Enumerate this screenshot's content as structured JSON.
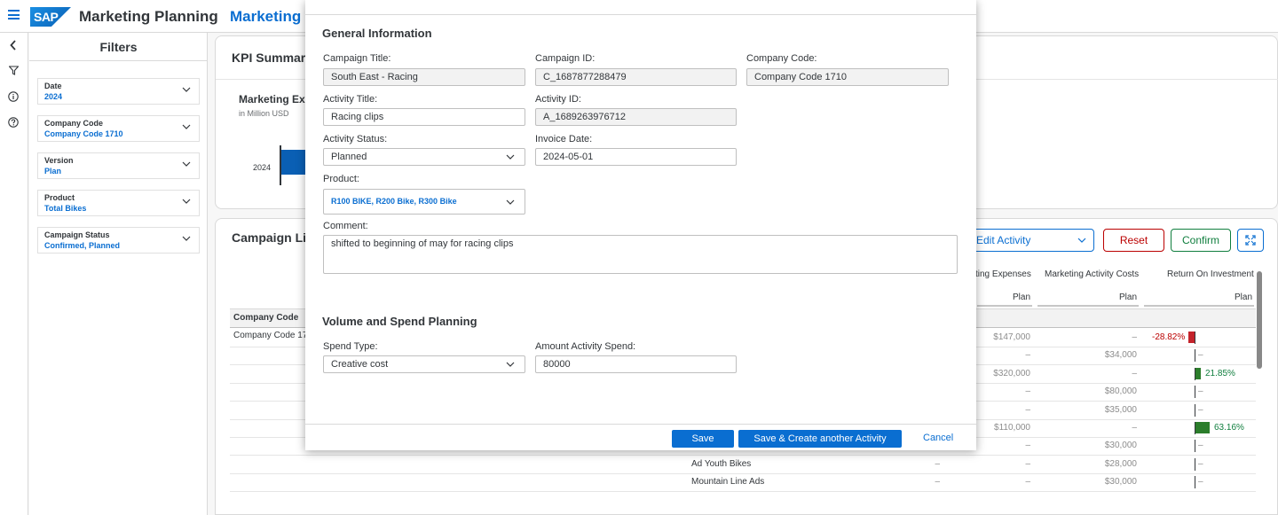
{
  "shell": {
    "logo": "SAP",
    "title": "Marketing Planning",
    "app_title": "Marketing Ca"
  },
  "filters": {
    "title": "Filters",
    "items": [
      {
        "label": "Date",
        "value": "2024"
      },
      {
        "label": "Company Code",
        "value": "Company Code 1710"
      },
      {
        "label": "Version",
        "value": "Plan"
      },
      {
        "label": "Product",
        "value": "Total Bikes"
      },
      {
        "label": "Campaign Status",
        "value": "Confirmed, Planned"
      }
    ]
  },
  "kpi": {
    "title": "KPI Summary",
    "chart_title": "Marketing Expe",
    "chart_subtitle": "in Million USD",
    "year": "2024"
  },
  "campaign_list": {
    "title": "Campaign List",
    "edit_activity": "Edit Activity",
    "reset": "Reset",
    "confirm": "Confirm",
    "columns": {
      "expenses": "ting Expenses",
      "activity_costs": "Marketing Activity Costs",
      "roi": "Return On Investment",
      "plan": "Plan"
    },
    "company_code_header": "Company Code",
    "company_code_value": "Company Code 17",
    "dash": "–",
    "rows": [
      {
        "name": "",
        "expenses": "$147,000",
        "costs": "–",
        "roi": "-28.82%"
      },
      {
        "name": "",
        "expenses": "–",
        "costs": "$34,000",
        "roi": "–"
      },
      {
        "name": "",
        "expenses": "$320,000",
        "costs": "–",
        "roi": "21.85%"
      },
      {
        "name": "",
        "expenses": "–",
        "costs": "$80,000",
        "roi": "–"
      },
      {
        "name": "",
        "expenses": "–",
        "costs": "$35,000",
        "roi": "–"
      },
      {
        "name": "",
        "expenses": "$110,000",
        "costs": "–",
        "roi": "63.16%"
      },
      {
        "name": "",
        "expenses": "–",
        "costs": "$30,000",
        "roi": "–"
      },
      {
        "name": "Ad Youth Bikes",
        "expenses": "–",
        "costs": "$28,000",
        "roi": "–"
      },
      {
        "name": "Mountain Line Ads",
        "expenses": "–",
        "costs": "$30,000",
        "roi": "–"
      }
    ]
  },
  "dialog": {
    "general_title": "General Information",
    "campaign_title_label": "Campaign Title:",
    "campaign_title_value": "South East - Racing",
    "campaign_id_label": "Campaign ID:",
    "campaign_id_value": "C_1687877288479",
    "company_code_label": "Company Code:",
    "company_code_value": "Company Code 1710",
    "activity_title_label": "Activity Title:",
    "activity_title_value": "Racing clips",
    "activity_id_label": "Activity ID:",
    "activity_id_value": "A_1689263976712",
    "activity_status_label": "Activity Status:",
    "activity_status_value": "Planned",
    "invoice_date_label": "Invoice Date:",
    "invoice_date_value": "2024-05-01",
    "product_label": "Product:",
    "product_value": "R100 BIKE, R200 Bike, R300 Bike",
    "comment_label": "Comment:",
    "comment_value": "shifted to beginning of may for racing clips",
    "volume_title": "Volume and Spend Planning",
    "spend_type_label": "Spend Type:",
    "spend_type_value": "Creative cost",
    "amount_label": "Amount Activity Spend:",
    "amount_value": "80000",
    "save": "Save",
    "save_create": "Save & Create another Activity",
    "cancel": "Cancel"
  },
  "colors": {
    "accent": "#0a6ed1",
    "negative": "#bb0000",
    "positive": "#107e3e",
    "roi_negative_bar": "#c4232b",
    "roi_positive_bar": "#2b7d2b"
  }
}
